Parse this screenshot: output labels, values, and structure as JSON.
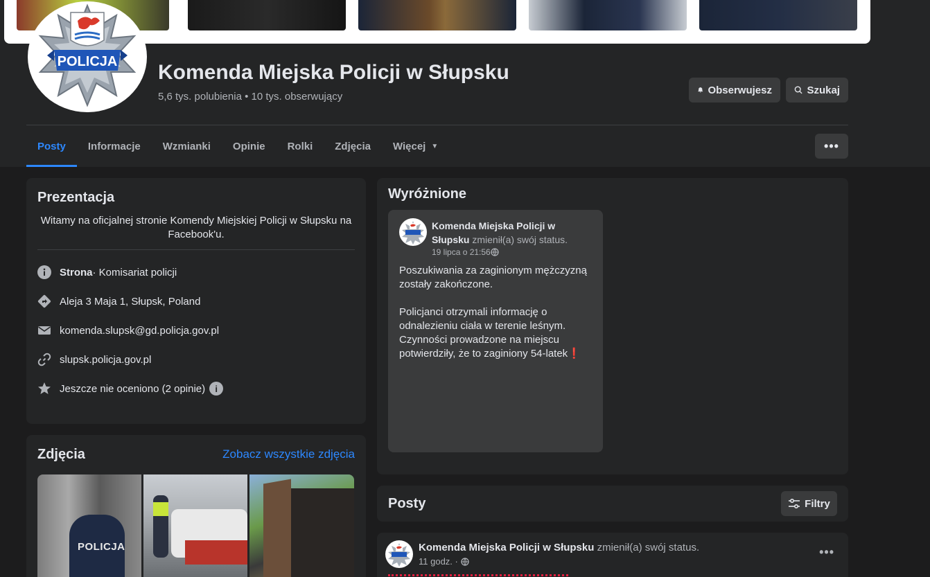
{
  "header": {
    "page_name": "Komenda Miejska Policji w Słupsku",
    "stats": "5,6 tys. polubienia • 10 tys. obserwujący",
    "logo_text": "POLICJA",
    "follow_label": "Obserwujesz",
    "search_label": "Szukaj"
  },
  "tabs": [
    {
      "label": "Posty",
      "active": true
    },
    {
      "label": "Informacje"
    },
    {
      "label": "Wzmianki"
    },
    {
      "label": "Opinie"
    },
    {
      "label": "Rolki"
    },
    {
      "label": "Zdjęcia"
    },
    {
      "label": "Więcej"
    }
  ],
  "intro": {
    "title": "Prezentacja",
    "description": "Witamy na oficjalnej stronie Komendy Miejskiej Policji w Słupsku na Facebook'u.",
    "category_prefix": "Strona",
    "category": " · Komisariat policji",
    "address": "Aleja 3 Maja 1, Słupsk, Poland",
    "email": "komenda.slupsk@gd.policja.gov.pl",
    "website": "slupsk.policja.gov.pl",
    "rating": "Jeszcze nie oceniono (2 opinie)"
  },
  "photos": {
    "title": "Zdjęcia",
    "see_all": "Zobacz wszystkie zdjęcia",
    "photo1_text": "POLICJA"
  },
  "featured": {
    "title": "Wyróżnione",
    "author": "Komenda Miejska Policji w Słupsku",
    "action": " zmienił(a) swój status.",
    "time": "19 lipca o 21:56",
    "paragraph1": "Poszukiwania za zaginionym mężczyzną zostały zakończone.",
    "paragraph2": "Policjanci otrzymali informację o odnalezieniu ciała w terenie leśnym. Czynności prowadzone na miejscu potwierdziły, że to zaginiony 54-latek",
    "emoji": "❗"
  },
  "posts": {
    "title": "Posty",
    "filters_label": "Filtry"
  },
  "post": {
    "author": "Komenda Miejska Policji w Słupsku",
    "action": " zmienił(a) swój status.",
    "time": "11 godz. ·"
  },
  "colors": {
    "accent": "#2d88ff",
    "card": "#242526",
    "background": "#1c1c1d",
    "alert": "#e41e3f"
  }
}
